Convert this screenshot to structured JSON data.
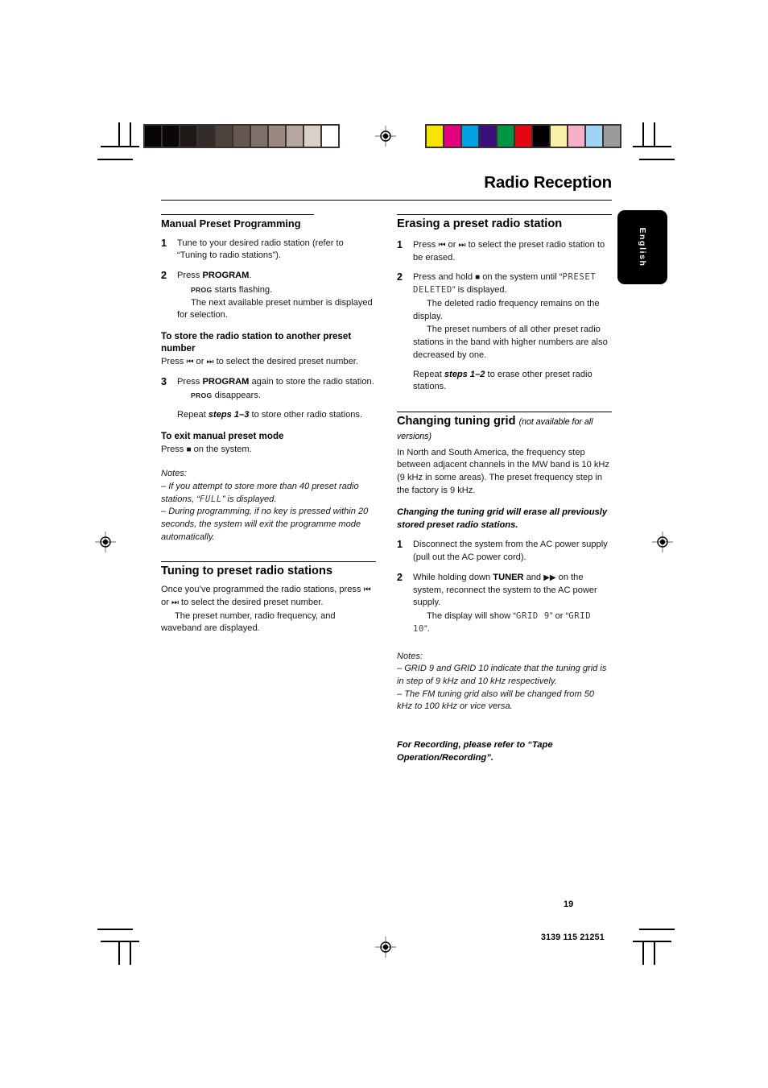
{
  "document": {
    "title": "Radio Reception",
    "language_tab": "English",
    "page_number": "19",
    "doc_code": "3139 115 21251"
  },
  "print_marks": {
    "grayscale_swatches": [
      "#050405",
      "#0b0707",
      "#1e1917",
      "#322c29",
      "#4a423d",
      "#63594f",
      "#7e7268",
      "#99897f",
      "#b5a79d",
      "#d8d0c9",
      "#ffffff"
    ],
    "color_swatches": [
      "#f5e500",
      "#e4007f",
      "#00a0e3",
      "#3b1078",
      "#009543",
      "#e30613",
      "#000000",
      "#faf0a8",
      "#f7b0c8",
      "#9fd4f2",
      "#9b9b9b"
    ]
  },
  "left_column": {
    "section1": {
      "heading": "Manual Preset Programming",
      "step1": {
        "num": "1",
        "text": "Tune to your desired radio station (refer to “Tuning to radio stations”)."
      },
      "step2": {
        "num": "2",
        "lead_press": "Press ",
        "lead_bold": "PROGRAM",
        "lead_end": ".",
        "prog_label": "PROG",
        "prog_text": " starts flashing.",
        "line3": "The next available preset number is displayed for selection."
      },
      "sub1": {
        "heading": "To store the radio station to another preset number",
        "text_a": "Press ",
        "glyph_prev": "⏮",
        "text_b": " or ",
        "glyph_next": "⏭",
        "text_c": " to select the desired preset number."
      },
      "step3": {
        "num": "3",
        "lead_press": "Press ",
        "lead_bold": "PROGRAM",
        "lead_end": " again to store the radio station.",
        "prog_label": "PROG",
        "prog_text": " disappears.",
        "repeat_a": "Repeat ",
        "repeat_bold": "steps 1–3",
        "repeat_b": " to store other radio stations."
      },
      "sub2": {
        "heading": "To exit manual preset mode",
        "text_a": "Press ",
        "glyph_stop": "■",
        "text_b": " on the system."
      },
      "notes": {
        "header": "Notes:",
        "note1_a": "–  If you attempt to store more than 40 preset radio stations, “",
        "note1_lcd": "FULL",
        "note1_b": "” is displayed.",
        "note2": "–  During programming, if no key is pressed within 20 seconds, the system will exit the programme mode automatically."
      }
    },
    "section2": {
      "heading": "Tuning to preset radio stations",
      "text_a": "Once you’ve programmed the radio stations, press ",
      "glyph_prev": "⏮",
      "text_b": " or ",
      "glyph_next": "⏭",
      "text_c": " to select the desired preset number.",
      "text_d": "The preset number, radio frequency, and waveband are displayed."
    }
  },
  "right_column": {
    "section1": {
      "heading": "Erasing a preset radio station",
      "step1": {
        "num": "1",
        "text_a": "Press ",
        "glyph_prev": "⏮",
        "text_b": " or ",
        "glyph_next": "⏭",
        "text_c": " to select the preset radio station to be erased."
      },
      "step2": {
        "num": "2",
        "text_a": "Press and hold ",
        "glyph_stop": "■",
        "text_b": " on the system until “",
        "lcd_1": "PRESET",
        "lcd_2": "DELETED",
        "text_c": "” is displayed.",
        "line2": "The deleted radio frequency remains on the display.",
        "line3": "The preset numbers of all other preset radio stations in the band with higher numbers are also decreased by one.",
        "repeat_a": "Repeat ",
        "repeat_bold": "steps 1–2",
        "repeat_b": " to erase other preset radio stations."
      }
    },
    "section2": {
      "heading": "Changing tuning grid",
      "heading_note": "(not available for all versions)",
      "paragraph": "In North and South America, the frequency step between adjacent channels in the MW band is 10 kHz (9 kHz in some areas). The preset frequency step in the factory is 9 kHz.",
      "warning": "Changing the tuning grid will erase all previously stored preset radio stations.",
      "step1": {
        "num": "1",
        "text": "Disconnect the system from the AC power supply (pull out the AC power cord)."
      },
      "step2": {
        "num": "2",
        "text_a": "While holding down ",
        "bold": "TUNER",
        "text_b": " and ",
        "glyph_ff": "▶▶",
        "text_c": " on the system, reconnect the system to the AC power supply.",
        "line2_a": "The display will show “",
        "lcd_1": "GRID 9",
        "line2_b": "” or “",
        "lcd_2": "GRID 10",
        "line2_c": "”."
      },
      "notes": {
        "header": "Notes:",
        "note1": "–  GRID 9 and GRID 10 indicate that the tuning grid is in step of 9 kHz and 10 kHz respectively.",
        "note2": "–  The FM tuning grid also will be changed from 50 kHz to 100 kHz or vice versa."
      }
    },
    "footer_note": "For Recording, please refer to “Tape Operation/Recording”."
  }
}
